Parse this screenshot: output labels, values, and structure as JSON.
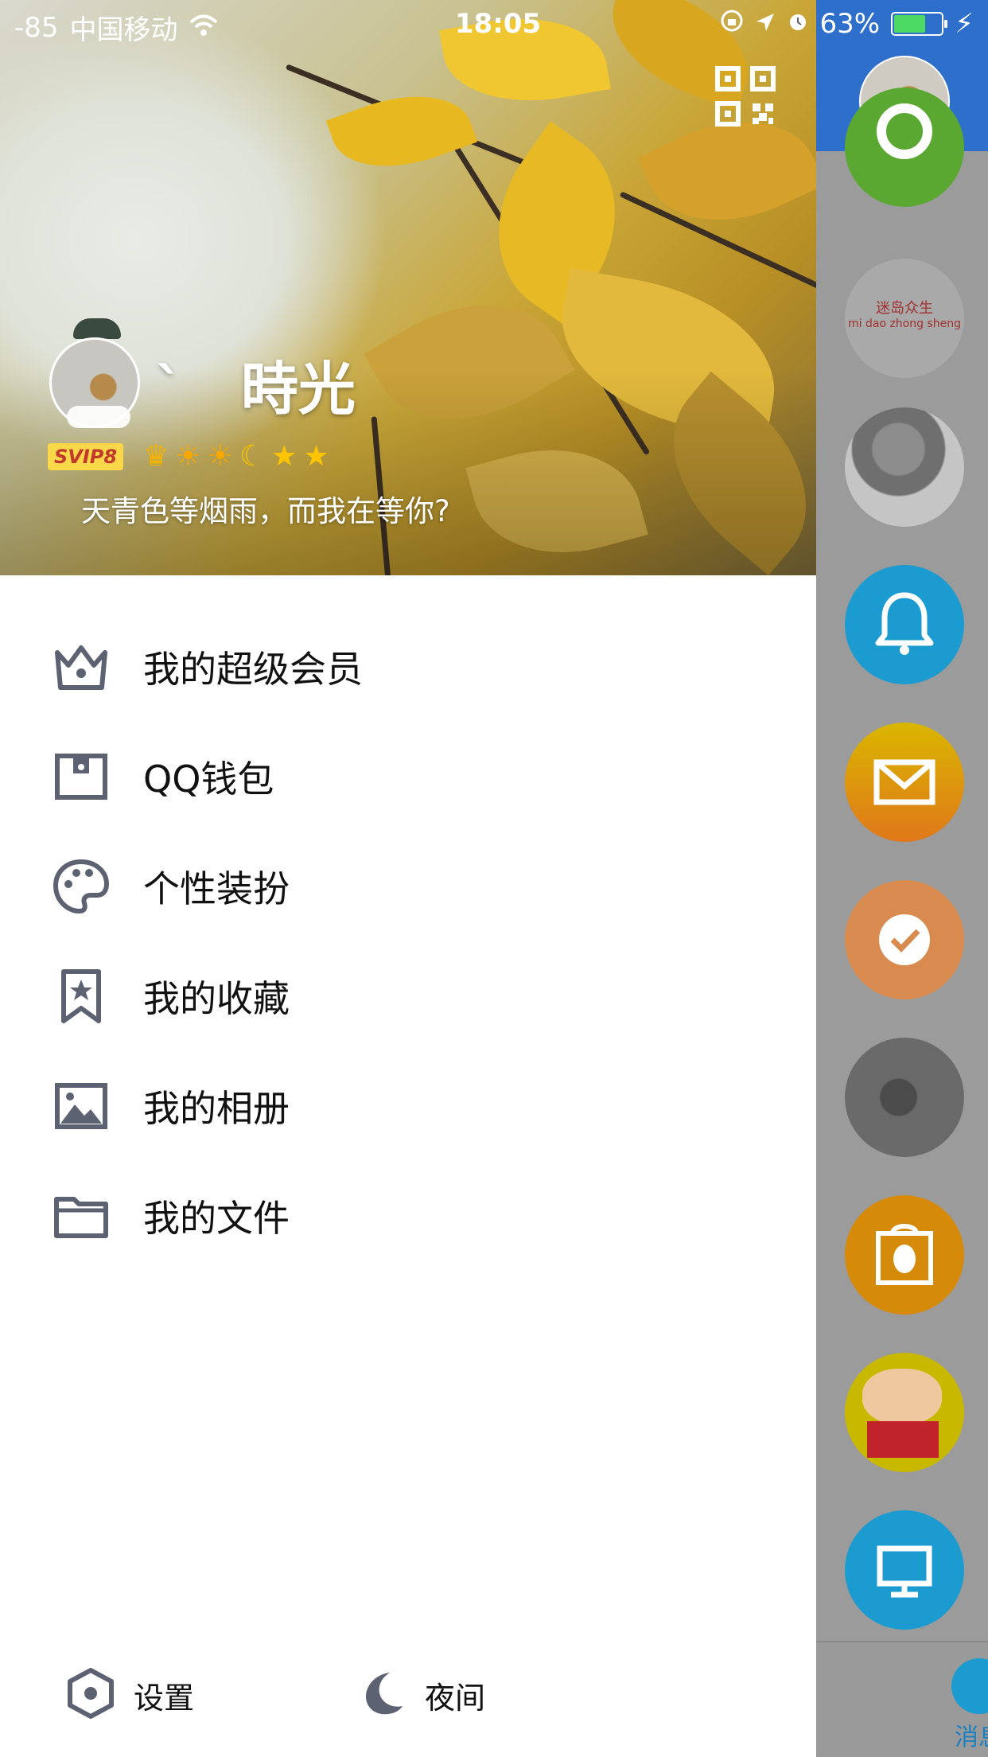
{
  "status_bar": {
    "signal": "-85",
    "carrier": "中国移动",
    "time": "18:05",
    "battery": "63%",
    "battery_level": 0.63
  },
  "profile": {
    "nickname": "`　時光",
    "badge": "SVIP8",
    "signature": "天青色等烟雨，而我在等你?"
  },
  "menu": [
    {
      "label": "我的超级会员",
      "icon": "crown-icon"
    },
    {
      "label": "QQ钱包",
      "icon": "wallet-icon"
    },
    {
      "label": "个性装扮",
      "icon": "palette-icon"
    },
    {
      "label": "我的收藏",
      "icon": "bookmark-star-icon"
    },
    {
      "label": "我的相册",
      "icon": "photo-icon"
    },
    {
      "label": "我的文件",
      "icon": "folder-icon"
    }
  ],
  "footer": {
    "settings_label": "设置",
    "night_label": "夜间"
  },
  "peek": {
    "avatar_text": "迷岛众生",
    "avatar_text_pinyin": "mi dao zhong sheng",
    "tab_label": "消息"
  },
  "colors": {
    "icon": "#5d6273",
    "header_blue": "#2f6fcc",
    "peek_bg": "#9b9b9b"
  }
}
